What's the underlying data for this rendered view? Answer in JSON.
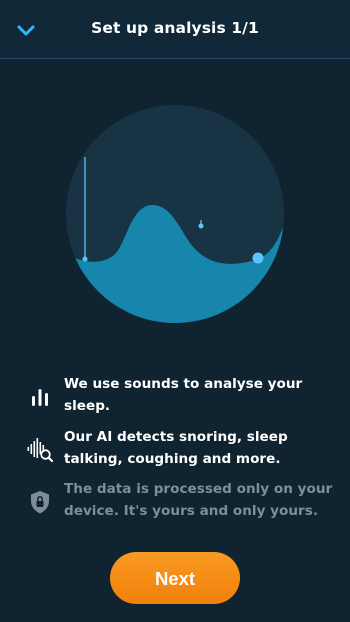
{
  "header": {
    "title": "Set up analysis 1/1",
    "back_icon": "chevron-down-icon"
  },
  "illustration": {
    "circle_color": "#183344",
    "wave_color": "#1786ad",
    "marker_color": "#59c7ff"
  },
  "items": [
    {
      "icon": "sound-bars-icon",
      "text": "We use sounds to analyse your sleep."
    },
    {
      "icon": "sound-search-icon",
      "text": "Our AI detects snoring, sleep talking, coughing and more."
    },
    {
      "icon": "lock-shield-icon",
      "text": "The data is processed only on your device. It's yours and only yours."
    }
  ],
  "next_button": {
    "label": "Next",
    "color": "#f58a12"
  }
}
